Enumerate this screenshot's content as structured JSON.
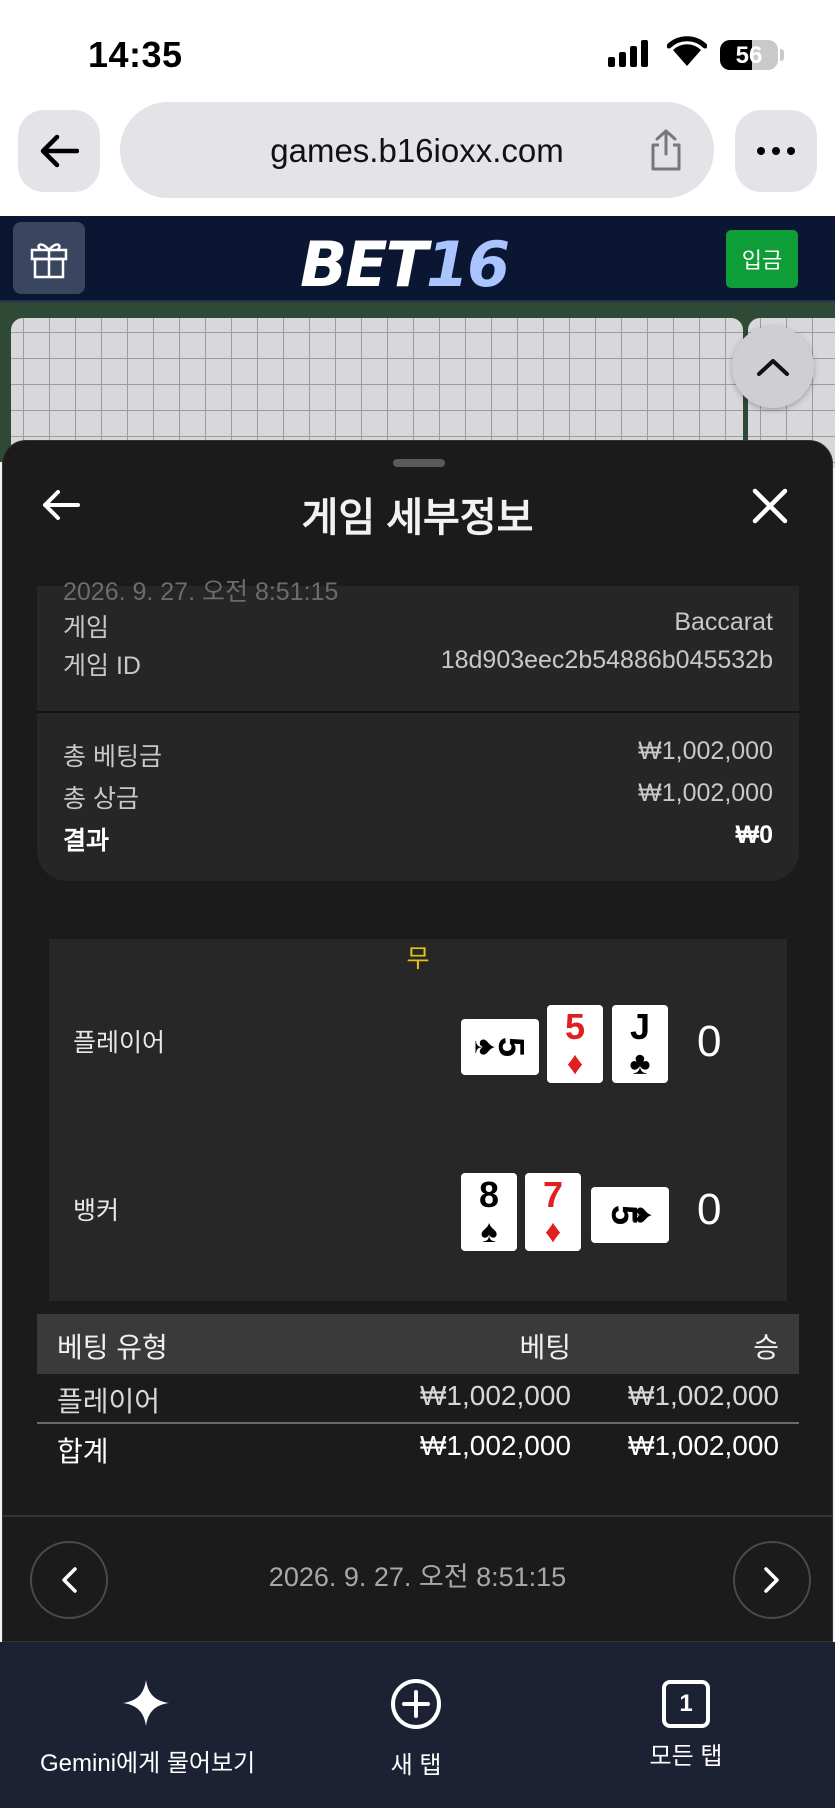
{
  "status_bar": {
    "time": "14:35",
    "battery": "56",
    "battery_level": 0.56
  },
  "browser": {
    "url": "games.b16ioxx.com"
  },
  "site": {
    "logo_prefix": "BET",
    "logo_number": "16",
    "deposit_label": "입금"
  },
  "sheet": {
    "title": "게임 세부정보",
    "faded_timestamp": "2026. 9. 27. 오전 8:51:15",
    "info": [
      {
        "label": "게임",
        "value": "Baccarat"
      },
      {
        "label": "게임 ID",
        "value": "18d903eec2b54886b045532b"
      }
    ],
    "totals": [
      {
        "label": "총 베팅금",
        "value": "₩1,002,000"
      },
      {
        "label": "총 상금",
        "value": "₩1,002,000"
      },
      {
        "label": "결과",
        "value": "₩0"
      }
    ],
    "game": {
      "result": "무",
      "player": {
        "label": "플레이어",
        "score": "0",
        "cards": [
          {
            "rank": "5",
            "suit": "♠",
            "color": "black",
            "orientation": "sideways"
          },
          {
            "rank": "5",
            "suit": "♦",
            "color": "red",
            "orientation": "upright"
          },
          {
            "rank": "J",
            "suit": "♣",
            "color": "black",
            "orientation": "upright"
          }
        ]
      },
      "banker": {
        "label": "뱅커",
        "score": "0",
        "cards": [
          {
            "rank": "8",
            "suit": "♠",
            "color": "black",
            "orientation": "upright"
          },
          {
            "rank": "7",
            "suit": "♦",
            "color": "red",
            "orientation": "upright"
          },
          {
            "rank": "5",
            "suit": "♠",
            "color": "black",
            "orientation": "sideways"
          }
        ]
      }
    },
    "table": {
      "headers": [
        "베팅 유형",
        "베팅",
        "승"
      ],
      "rows": [
        [
          "플레이어",
          "₩1,002,000",
          "₩1,002,000"
        ]
      ],
      "total": [
        "합계",
        "₩1,002,000",
        "₩1,002,000"
      ]
    },
    "footer_date": "2026. 9. 27. 오전 8:51:15"
  },
  "bottom_bar": {
    "gemini_label": "Gemini에게 물어보기",
    "new_tab_label": "새 탭",
    "all_tabs_label": "모든 탭",
    "tab_count": "1"
  },
  "colors": {
    "site_header": "#0b1633",
    "deposit": "#0f9d37",
    "sheet_bg": "#1b1b1b",
    "tie": "#e2c316",
    "red_suit": "#e02020"
  }
}
